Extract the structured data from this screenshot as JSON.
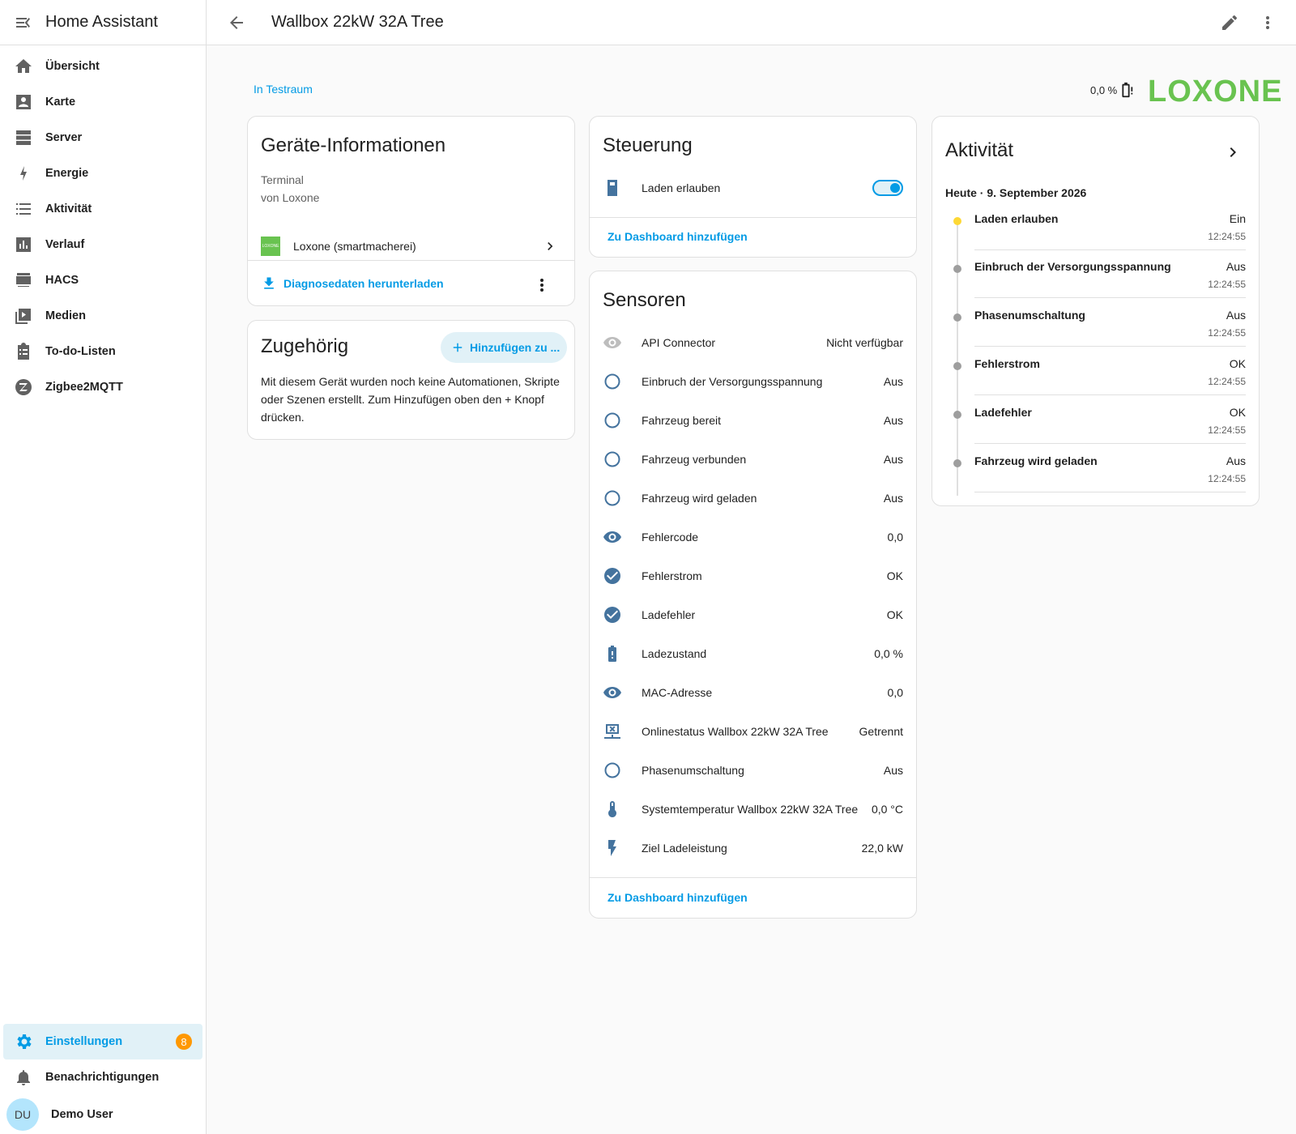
{
  "app": {
    "title": "Home Assistant"
  },
  "sidebar": {
    "items": [
      {
        "label": "Übersicht",
        "icon": "home-icon"
      },
      {
        "label": "Karte",
        "icon": "map-account-icon"
      },
      {
        "label": "Server",
        "icon": "server-icon"
      },
      {
        "label": "Energie",
        "icon": "lightning-icon"
      },
      {
        "label": "Aktivität",
        "icon": "list-icon"
      },
      {
        "label": "Verlauf",
        "icon": "chart-bar-icon"
      },
      {
        "label": "HACS",
        "icon": "hacs-icon"
      },
      {
        "label": "Medien",
        "icon": "media-icon"
      },
      {
        "label": "To-do-Listen",
        "icon": "clipboard-list-icon"
      },
      {
        "label": "Zigbee2MQTT",
        "icon": "zigbee-icon"
      }
    ],
    "settings": {
      "label": "Einstellungen",
      "badge": "8"
    },
    "notifications": {
      "label": "Benachrichtigungen"
    },
    "user": {
      "initials": "DU",
      "name": "Demo User"
    }
  },
  "topbar": {
    "title": "Wallbox 22kW 32A Tree"
  },
  "header": {
    "area": "In Testraum",
    "battery": "0,0 %",
    "brand": "LOXONE"
  },
  "device_info": {
    "title": "Geräte-Informationen",
    "model": "Terminal",
    "manufacturer": "von Loxone",
    "integration_logo": "LOXONE",
    "integration": "Loxone (smartmacherei)",
    "diagnostics": "Diagnosedaten herunterladen"
  },
  "related": {
    "title": "Zugehörig",
    "add_button": "Hinzufügen zu ...",
    "text": "Mit diesem Gerät wurden noch keine Automationen, Skripte oder Szenen erstellt. Zum Hinzufügen oben den + Knopf drücken."
  },
  "control": {
    "title": "Steuerung",
    "entities": [
      {
        "name": "Laden erlauben",
        "state": "on"
      }
    ],
    "add_dashboard": "Zu Dashboard hinzufügen"
  },
  "sensors": {
    "title": "Sensoren",
    "entities": [
      {
        "name": "API Connector",
        "state": "Nicht verfügbar",
        "icon": "eye-icon",
        "muted": true
      },
      {
        "name": "Einbruch der Versorgungsspannung",
        "state": "Aus",
        "icon": "circle-outline-icon"
      },
      {
        "name": "Fahrzeug bereit",
        "state": "Aus",
        "icon": "circle-outline-icon"
      },
      {
        "name": "Fahrzeug verbunden",
        "state": "Aus",
        "icon": "circle-outline-icon"
      },
      {
        "name": "Fahrzeug wird geladen",
        "state": "Aus",
        "icon": "circle-outline-icon"
      },
      {
        "name": "Fehlercode",
        "state": "0,0",
        "icon": "eye-icon"
      },
      {
        "name": "Fehlerstrom",
        "state": "OK",
        "icon": "check-circle-icon"
      },
      {
        "name": "Ladefehler",
        "state": "OK",
        "icon": "check-circle-icon"
      },
      {
        "name": "Ladezustand",
        "state": "0,0 %",
        "icon": "battery-alert-icon"
      },
      {
        "name": "MAC-Adresse",
        "state": "0,0",
        "icon": "eye-icon"
      },
      {
        "name": "Onlinestatus Wallbox 22kW 32A Tree",
        "state": "Getrennt",
        "icon": "network-off-icon"
      },
      {
        "name": "Phasenumschaltung",
        "state": "Aus",
        "icon": "circle-outline-icon"
      },
      {
        "name": "Systemtemperatur Wallbox 22kW 32A Tree",
        "state": "0,0 °C",
        "icon": "thermometer-icon"
      },
      {
        "name": "Ziel Ladeleistung",
        "state": "22,0 kW",
        "icon": "flash-icon"
      }
    ],
    "add_dashboard": "Zu Dashboard hinzufügen"
  },
  "activity": {
    "title": "Aktivität",
    "date": "Heute · 9. September 2026",
    "entries": [
      {
        "name": "Laden erlauben",
        "state": "Ein",
        "time": "12:24:55",
        "on": true
      },
      {
        "name": "Einbruch der Versorgungsspannung",
        "state": "Aus",
        "time": "12:24:55"
      },
      {
        "name": "Phasenumschaltung",
        "state": "Aus",
        "time": "12:24:55"
      },
      {
        "name": "Fehlerstrom",
        "state": "OK",
        "time": "12:24:55"
      },
      {
        "name": "Ladefehler",
        "state": "OK",
        "time": "12:24:55"
      },
      {
        "name": "Fahrzeug wird geladen",
        "state": "Aus",
        "time": "12:24:55"
      }
    ]
  },
  "colors": {
    "primary": "#039be5",
    "icon": "#44739e",
    "loxone_green": "#69c350",
    "badge": "#ff9800"
  }
}
